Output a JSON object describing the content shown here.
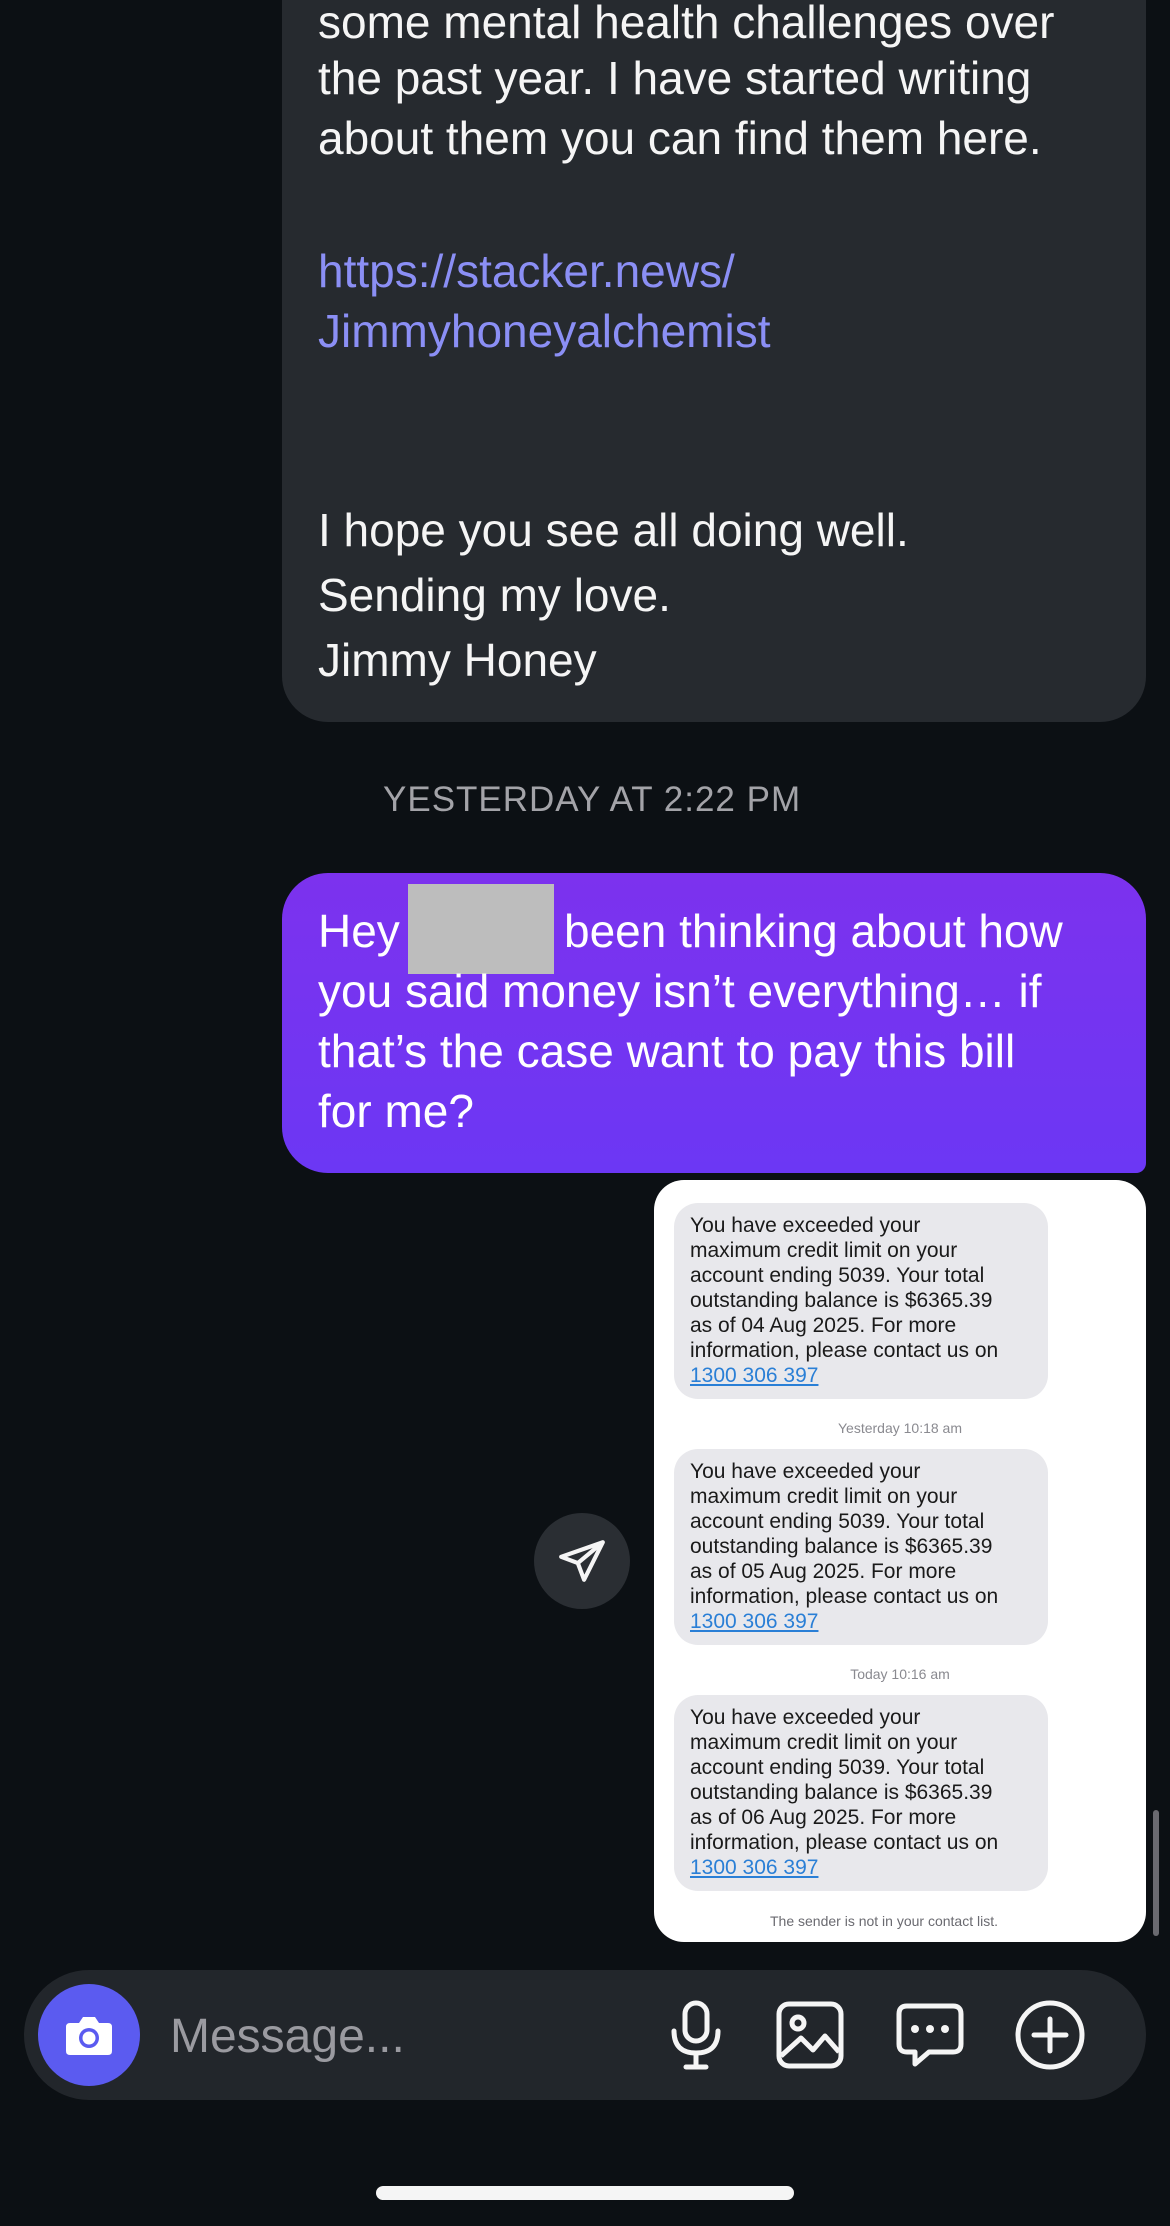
{
  "incoming_message": {
    "lines": [
      "some mental health challenges over",
      "the past year. I have started writing",
      "about them you can find them here."
    ],
    "link_lines": [
      "https://stacker.news/",
      "Jimmyhoneyalchemist"
    ],
    "closing_lines": [
      "I hope you see all doing well.",
      "Sending my love.",
      "Jimmy Honey"
    ]
  },
  "timestamp": "YESTERDAY AT 2:22 PM",
  "outgoing_message": {
    "line1_start": "Hey",
    "line1_end": "been thinking about how",
    "line2": "you said money isn’t everything… if",
    "line3": "that’s the case want to pay this bill",
    "line4": "for me?"
  },
  "attachment": {
    "sms_messages": [
      {
        "lines": [
          "You have exceeded your",
          "maximum credit limit on your",
          "account ending 5039. Your total",
          "outstanding balance is $6365.39",
          "as of 04 Aug 2025. For more",
          "information, please contact us on"
        ],
        "phone": "1300 306 397"
      },
      {
        "lines": [
          "You have exceeded your",
          "maximum credit limit on your",
          "account ending 5039. Your total",
          "outstanding balance is $6365.39",
          "as of 05 Aug 2025. For more",
          "information, please contact us on"
        ],
        "phone": "1300 306 397"
      },
      {
        "lines": [
          "You have exceeded your",
          "maximum credit limit on your",
          "account ending 5039. Your total",
          "outstanding balance is $6365.39",
          "as of 06 Aug 2025. For more",
          "information, please contact us on"
        ],
        "phone": "1300 306 397"
      }
    ],
    "stamps": [
      "Yesterday 10:18 am",
      "Today 10:16 am"
    ],
    "footer_note": "The sender is not in your contact list."
  },
  "composer": {
    "placeholder": "Message...",
    "icons": [
      "camera-icon",
      "microphone-icon",
      "gallery-icon",
      "sticker-icon",
      "plus-icon"
    ]
  },
  "colors": {
    "background": "#0c1014",
    "incoming_bubble": "#262a2f",
    "outgoing_bubble": "#7c32ee",
    "link": "#8b8ff5",
    "camera_button": "#5b5bf0"
  }
}
